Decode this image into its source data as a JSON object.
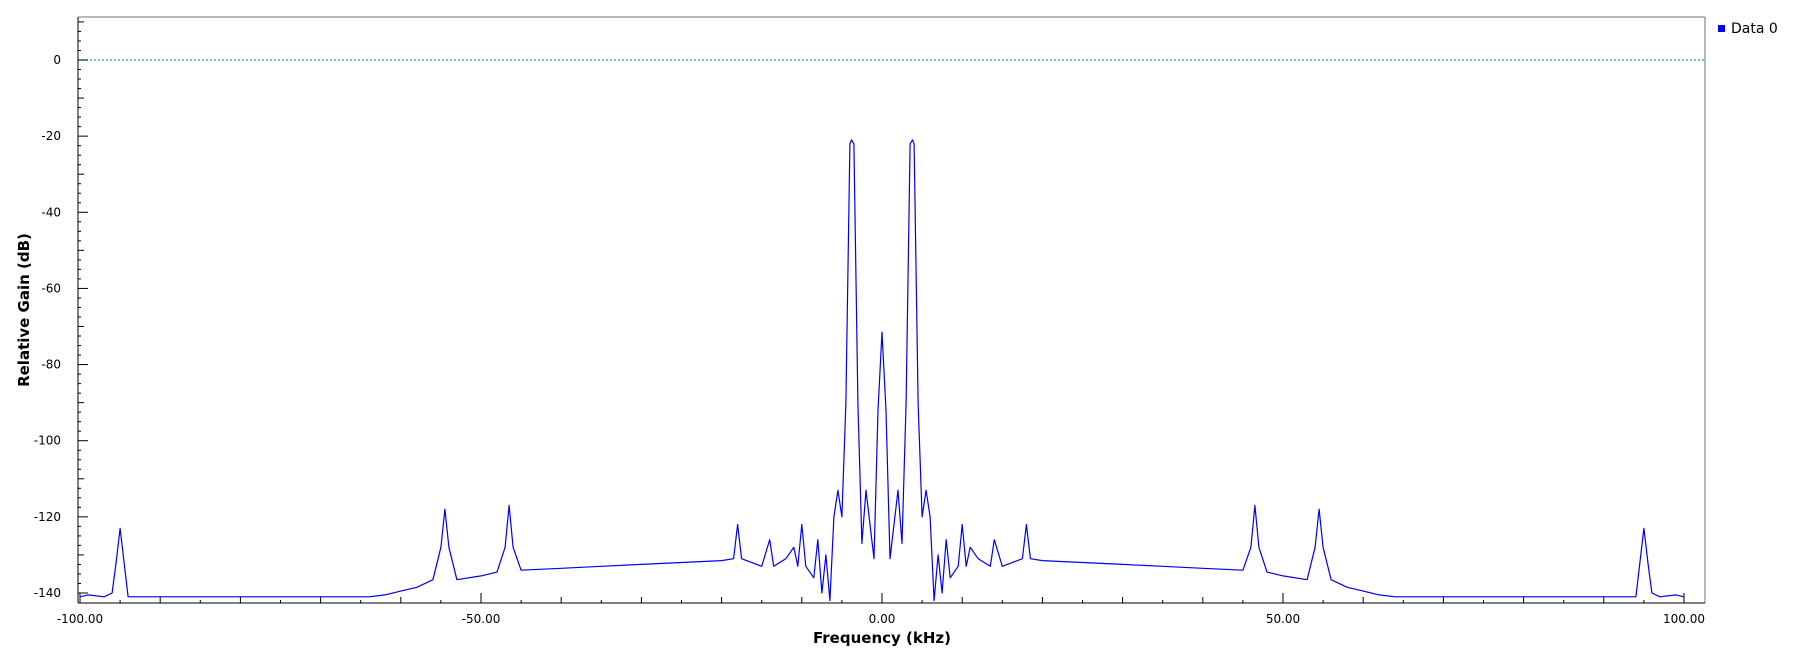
{
  "chart_data": {
    "type": "line",
    "title": "",
    "xlabel": "Frequency (kHz)",
    "ylabel": "Relative Gain (dB)",
    "xlim": [
      -100,
      100
    ],
    "ylim": [
      -140,
      10
    ],
    "x_ticks": [
      -100,
      -50,
      0,
      50,
      100
    ],
    "x_tick_labels": [
      "-100.00",
      "-50.00",
      "0.00",
      "50.00",
      "100.00"
    ],
    "y_ticks": [
      0,
      -20,
      -40,
      -60,
      -80,
      -100,
      -120,
      -140
    ],
    "y_tick_labels": [
      "0",
      "-20",
      "-40",
      "-60",
      "-80",
      "-100",
      "-120",
      "-140"
    ],
    "legend_position": "top-right",
    "grid": false,
    "reference_line": {
      "y": 0,
      "style": "dotted",
      "color": "#1aa0a8"
    },
    "series": [
      {
        "name": "Data 0",
        "color": "#0000ee",
        "points": [
          [
            -100,
            -141
          ],
          [
            -99,
            -140.5
          ],
          [
            -97,
            -141
          ],
          [
            -96,
            -140
          ],
          [
            -95.5,
            -132
          ],
          [
            -95,
            -123
          ],
          [
            -94.5,
            -132
          ],
          [
            -94,
            -141
          ],
          [
            -92,
            -141
          ],
          [
            -91,
            -141
          ],
          [
            -90,
            -141
          ],
          [
            -64,
            -141
          ],
          [
            -62,
            -140.5
          ],
          [
            -60,
            -139.5
          ],
          [
            -58,
            -138.5
          ],
          [
            -56,
            -136.5
          ],
          [
            -55,
            -128
          ],
          [
            -54.5,
            -118
          ],
          [
            -54,
            -128
          ],
          [
            -53,
            -136.5
          ],
          [
            -50,
            -135.5
          ],
          [
            -48,
            -134.5
          ],
          [
            -47,
            -128
          ],
          [
            -46.5,
            -117
          ],
          [
            -46,
            -128
          ],
          [
            -45,
            -134
          ],
          [
            -40,
            -133.5
          ],
          [
            -35,
            -133
          ],
          [
            -30,
            -132.5
          ],
          [
            -25,
            -132
          ],
          [
            -20,
            -131.5
          ],
          [
            -18.5,
            -131
          ],
          [
            -18,
            -122
          ],
          [
            -17.5,
            -131
          ],
          [
            -15,
            -133
          ],
          [
            -14,
            -126
          ],
          [
            -13.5,
            -133
          ],
          [
            -12,
            -131
          ],
          [
            -11,
            -128
          ],
          [
            -10.5,
            -133
          ],
          [
            -10,
            -122
          ],
          [
            -9.5,
            -133
          ],
          [
            -8.5,
            -136
          ],
          [
            -8,
            -126
          ],
          [
            -7.5,
            -140
          ],
          [
            -7,
            -130
          ],
          [
            -6.5,
            -142
          ],
          [
            -6,
            -120
          ],
          [
            -5.5,
            -113
          ],
          [
            -5,
            -120
          ],
          [
            -4.5,
            -90
          ],
          [
            -4,
            -22
          ],
          [
            -3.8,
            -21
          ],
          [
            -3.5,
            -22
          ],
          [
            -3,
            -90
          ],
          [
            -2.5,
            -127
          ],
          [
            -2,
            -113
          ],
          [
            -1.5,
            -122
          ],
          [
            -1,
            -131
          ],
          [
            -0.5,
            -92
          ],
          [
            0,
            -71.5
          ],
          [
            0.5,
            -92
          ],
          [
            1,
            -131
          ],
          [
            1.5,
            -122
          ],
          [
            2,
            -113
          ],
          [
            2.5,
            -127
          ],
          [
            3,
            -90
          ],
          [
            3.5,
            -22
          ],
          [
            3.8,
            -21
          ],
          [
            4,
            -22
          ],
          [
            4.5,
            -90
          ],
          [
            5,
            -120
          ],
          [
            5.5,
            -113
          ],
          [
            6,
            -120
          ],
          [
            6.5,
            -142
          ],
          [
            7,
            -130
          ],
          [
            7.5,
            -140
          ],
          [
            8,
            -126
          ],
          [
            8.5,
            -136
          ],
          [
            9.5,
            -133
          ],
          [
            10,
            -122
          ],
          [
            10.5,
            -133
          ],
          [
            11,
            -128
          ],
          [
            12,
            -131
          ],
          [
            13.5,
            -133
          ],
          [
            14,
            -126
          ],
          [
            15,
            -133
          ],
          [
            17.5,
            -131
          ],
          [
            18,
            -122
          ],
          [
            18.5,
            -131
          ],
          [
            20,
            -131.5
          ],
          [
            25,
            -132
          ],
          [
            30,
            -132.5
          ],
          [
            35,
            -133
          ],
          [
            40,
            -133.5
          ],
          [
            45,
            -134
          ],
          [
            46,
            -128
          ],
          [
            46.5,
            -117
          ],
          [
            47,
            -128
          ],
          [
            48,
            -134.5
          ],
          [
            50,
            -135.5
          ],
          [
            53,
            -136.5
          ],
          [
            54,
            -128
          ],
          [
            54.5,
            -118
          ],
          [
            55,
            -128
          ],
          [
            56,
            -136.5
          ],
          [
            58,
            -138.5
          ],
          [
            60,
            -139.5
          ],
          [
            62,
            -140.5
          ],
          [
            64,
            -141
          ],
          [
            90,
            -141
          ],
          [
            91,
            -141
          ],
          [
            92,
            -141
          ],
          [
            94,
            -141
          ],
          [
            94.5,
            -132
          ],
          [
            95,
            -123
          ],
          [
            95.5,
            -132
          ],
          [
            96,
            -140
          ],
          [
            97,
            -141
          ],
          [
            99,
            -140.5
          ],
          [
            100,
            -141
          ]
        ]
      }
    ]
  }
}
